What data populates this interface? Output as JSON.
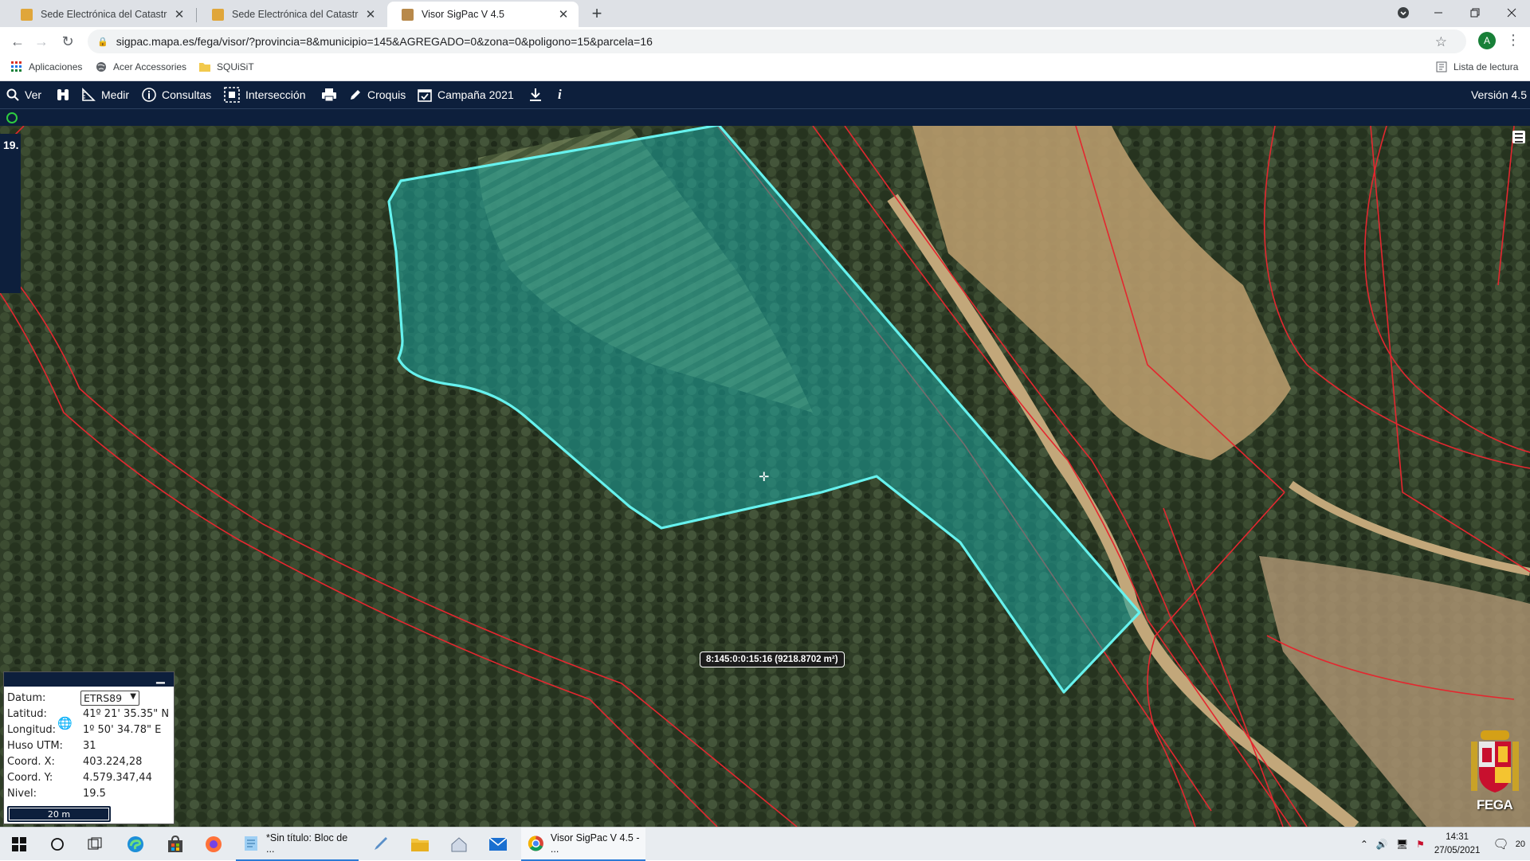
{
  "browser": {
    "tabs": [
      {
        "title": "Sede Electrónica del Catastro - C",
        "active": false
      },
      {
        "title": "Sede Electrónica del Catastro",
        "active": false
      },
      {
        "title": "Visor SigPac V 4.5",
        "active": true
      }
    ],
    "new_tab": "+",
    "url": "sigpac.mapa.es/fega/visor/?provincia=8&municipio=145&AGREGADO=0&zona=0&poligono=15&parcela=16",
    "profile_initial": "A"
  },
  "bookmarks": {
    "items": [
      "Aplicaciones",
      "Acer Accessories",
      "SQUiSiT"
    ],
    "reading_list": "Lista de lectura"
  },
  "toolbar": {
    "ver": "Ver",
    "medir": "Medir",
    "consultas": "Consultas",
    "interseccion": "Intersección",
    "croquis": "Croquis",
    "campana": "Campaña 2021",
    "info": "i",
    "version": "Versión 4.5"
  },
  "map": {
    "zoom_indicator": "19.",
    "parcel_label": "8:145:0:0:15:16 (9218.8702 m²)",
    "logo_text": "FEGA",
    "colors": {
      "parcel_fill": "#1ba6a0",
      "parcel_stroke": "#66f2ee",
      "boundary": "#e3272f",
      "forest": "#2f3d27",
      "path": "#b79a6c"
    }
  },
  "coords": {
    "datum_label": "Datum:",
    "datum_value": "ETRS89",
    "lat_label": "Latitud:",
    "lat_value": "41º 21' 35.35\" N",
    "lon_label": "Longitud:",
    "lon_value": "1º 50' 34.78\" E",
    "huso_label": "Huso UTM:",
    "huso_value": "31",
    "x_label": "Coord. X:",
    "x_value": "403.224,28",
    "y_label": "Coord. Y:",
    "y_value": "4.579.347,44",
    "nivel_label": "Nivel:",
    "nivel_value": "19.5",
    "scale": "20 m"
  },
  "taskbar": {
    "apps": [
      {
        "title": "*Sin título: Bloc de ..."
      },
      {
        "title": "Visor SigPac V 4.5 - ..."
      }
    ],
    "time": "14:31",
    "date": "27/05/2021",
    "notifications": "20"
  }
}
